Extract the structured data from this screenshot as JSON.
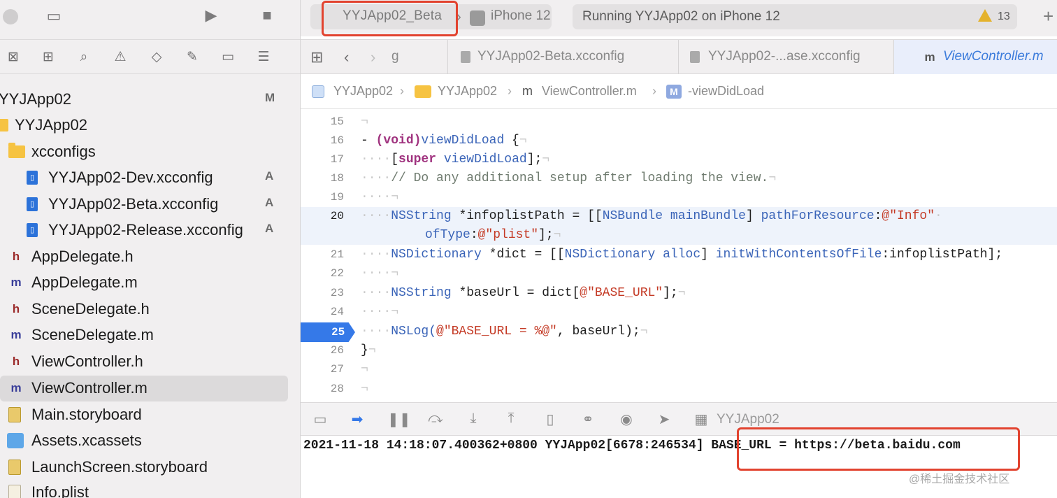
{
  "window": {
    "scheme_name": "YYJApp02_Beta",
    "device_name": "iPhone 12",
    "status_text": "Running YYJApp02 on iPhone 12",
    "warning_count": "13"
  },
  "sidebar": {
    "project_badge": "M",
    "items": [
      {
        "label": "YYJApp02",
        "badge": "M",
        "type": "project"
      },
      {
        "label": "YYJApp02",
        "badge": "",
        "type": "folder"
      },
      {
        "label": "xcconfigs",
        "badge": "",
        "type": "folder"
      },
      {
        "label": "YYJApp02-Dev.xcconfig",
        "badge": "A",
        "type": "xcconfig"
      },
      {
        "label": "YYJApp02-Beta.xcconfig",
        "badge": "A",
        "type": "xcconfig"
      },
      {
        "label": "YYJApp02-Release.xcconfig",
        "badge": "A",
        "type": "xcconfig"
      },
      {
        "label": "AppDelegate.h",
        "badge": "",
        "type": "h"
      },
      {
        "label": "AppDelegate.m",
        "badge": "",
        "type": "m"
      },
      {
        "label": "SceneDelegate.h",
        "badge": "",
        "type": "h"
      },
      {
        "label": "SceneDelegate.m",
        "badge": "",
        "type": "m"
      },
      {
        "label": "ViewController.h",
        "badge": "",
        "type": "h"
      },
      {
        "label": "ViewController.m",
        "badge": "",
        "type": "m"
      },
      {
        "label": "Main.storyboard",
        "badge": "",
        "type": "storyboard"
      },
      {
        "label": "Assets.xcassets",
        "badge": "",
        "type": "assets"
      },
      {
        "label": "LaunchScreen.storyboard",
        "badge": "",
        "type": "storyboard"
      },
      {
        "label": "Info.plist",
        "badge": "",
        "type": "plist"
      }
    ]
  },
  "tabs": [
    {
      "label": "g"
    },
    {
      "label": "YYJApp02-Beta.xcconfig"
    },
    {
      "label": "YYJApp02-...ase.xcconfig"
    },
    {
      "label": "ViewController.m"
    }
  ],
  "breadcrumb": {
    "project": "YYJApp02",
    "group": "YYJApp02",
    "file": "ViewController.m",
    "method": "-viewDidLoad",
    "file_icon": "m",
    "method_icon": "M"
  },
  "editor": {
    "line_numbers": [
      "15",
      "16",
      "17",
      "18",
      "19",
      "20",
      "21",
      "22",
      "23",
      "24",
      "25",
      "26",
      "27",
      "28"
    ],
    "current_line": "20",
    "breakpoint_line": "25",
    "code": {
      "l16_dash": "- ",
      "l16_ret": "(void)",
      "l16_name": "viewDidLoad",
      "l16_rest": " {",
      "l17_kw": "super",
      "l17_mth": "viewDidLoad",
      "l18_cmt": "// Do any additional setup after loading the view.",
      "l20_cls": "NSString",
      "l20_var": " *infoplistPath = [[",
      "l20_cls2": "NSBundle",
      "l20_mth": "mainBundle",
      "l20_mth2": "pathForResource",
      "l20_str": "@\"Info\"",
      "l20b_mth": "ofType",
      "l20b_str": "@\"plist\"",
      "l21_cls": "NSDictionary",
      "l21_var": " *dict = [[",
      "l21_cls2": "NSDictionary",
      "l21_mth": "alloc",
      "l21_mth2": "initWithContentsOfFile",
      "l21_rest": ":infoplistPath];",
      "l23_cls": "NSString",
      "l23_var": " *baseUrl = dict[",
      "l23_str": "@\"BASE_URL\"",
      "l23_rest": "];",
      "l25_fn": "NSLog(",
      "l25_str": "@\"BASE_URL = %@\"",
      "l25_rest": ", baseUrl);",
      "l26": "}"
    }
  },
  "debug": {
    "target": "YYJApp02"
  },
  "console": {
    "log": "2021-11-18 14:18:07.400362+0800 YYJApp02[6678:246534] BASE_URL = https://beta.baidu.com"
  },
  "watermark": "@稀土掘金技术社区"
}
